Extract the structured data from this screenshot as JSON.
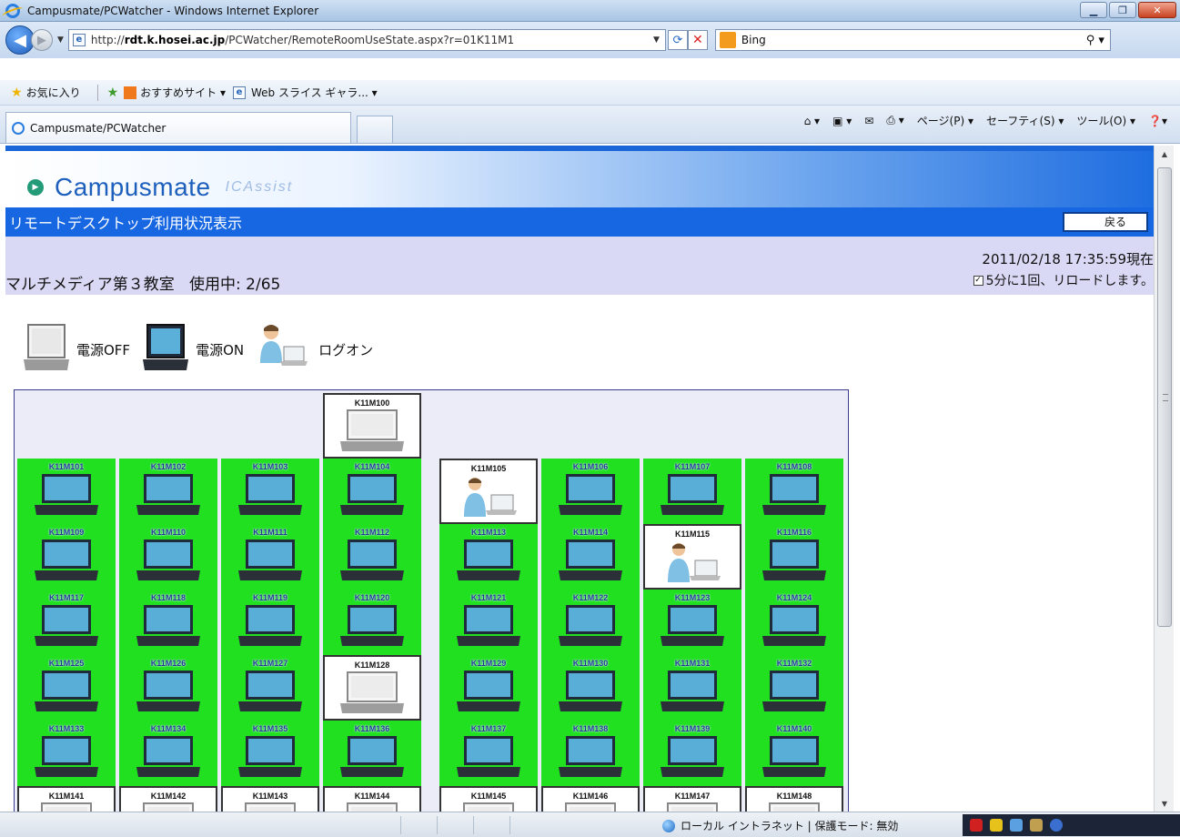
{
  "browser": {
    "title": "Campusmate/PCWatcher - Windows Internet Explorer",
    "url_prefix": "http://",
    "url_host": "rdt.k.hosei.ac.jp",
    "url_path": "/PCWatcher/RemoteRoomUseState.aspx?r=01K11M1",
    "search_engine": "Bing",
    "favorites_label": "お気に入り",
    "suggested_sites": "おすすめサイト ▾",
    "web_slice": "Web スライス ギャラ... ▾",
    "tab_title": "Campusmate/PCWatcher",
    "commands": {
      "page": "ページ(P) ▾",
      "safety": "セーフティ(S) ▾",
      "tools": "ツール(O) ▾"
    }
  },
  "page": {
    "brand": "Campusmate",
    "brand_sub": "ICAssist",
    "title": "リモートデスクトップ利用状況表示",
    "back_label": "戻る",
    "room_name": "マルチメディア第３教室",
    "usage": "使用中: 2/65",
    "timestamp": "2011/02/18 17:35:59現在",
    "reload_text": "5分に1回、リロードします。",
    "reload_checked": true,
    "legend": {
      "off": "電源OFF",
      "on": "電源ON",
      "logon": "ログオン"
    },
    "seats": [
      {
        "id": "K11M100",
        "status": "off"
      },
      {
        "id": "K11M101",
        "status": "on"
      },
      {
        "id": "K11M102",
        "status": "on"
      },
      {
        "id": "K11M103",
        "status": "on"
      },
      {
        "id": "K11M104",
        "status": "on"
      },
      {
        "id": "K11M105",
        "status": "logon"
      },
      {
        "id": "K11M106",
        "status": "on"
      },
      {
        "id": "K11M107",
        "status": "on"
      },
      {
        "id": "K11M108",
        "status": "on"
      },
      {
        "id": "K11M109",
        "status": "on"
      },
      {
        "id": "K11M110",
        "status": "on"
      },
      {
        "id": "K11M111",
        "status": "on"
      },
      {
        "id": "K11M112",
        "status": "on"
      },
      {
        "id": "K11M113",
        "status": "on"
      },
      {
        "id": "K11M114",
        "status": "on"
      },
      {
        "id": "K11M115",
        "status": "logon"
      },
      {
        "id": "K11M116",
        "status": "on"
      },
      {
        "id": "K11M117",
        "status": "on"
      },
      {
        "id": "K11M118",
        "status": "on"
      },
      {
        "id": "K11M119",
        "status": "on"
      },
      {
        "id": "K11M120",
        "status": "on"
      },
      {
        "id": "K11M121",
        "status": "on"
      },
      {
        "id": "K11M122",
        "status": "on"
      },
      {
        "id": "K11M123",
        "status": "on"
      },
      {
        "id": "K11M124",
        "status": "on"
      },
      {
        "id": "K11M125",
        "status": "on"
      },
      {
        "id": "K11M126",
        "status": "on"
      },
      {
        "id": "K11M127",
        "status": "on"
      },
      {
        "id": "K11M128",
        "status": "off"
      },
      {
        "id": "K11M129",
        "status": "on"
      },
      {
        "id": "K11M130",
        "status": "on"
      },
      {
        "id": "K11M131",
        "status": "on"
      },
      {
        "id": "K11M132",
        "status": "on"
      },
      {
        "id": "K11M133",
        "status": "on"
      },
      {
        "id": "K11M134",
        "status": "on"
      },
      {
        "id": "K11M135",
        "status": "on"
      },
      {
        "id": "K11M136",
        "status": "on"
      },
      {
        "id": "K11M137",
        "status": "on"
      },
      {
        "id": "K11M138",
        "status": "on"
      },
      {
        "id": "K11M139",
        "status": "on"
      },
      {
        "id": "K11M140",
        "status": "on"
      },
      {
        "id": "K11M141",
        "status": "off"
      },
      {
        "id": "K11M142",
        "status": "off"
      },
      {
        "id": "K11M143",
        "status": "off"
      },
      {
        "id": "K11M144",
        "status": "off"
      },
      {
        "id": "K11M145",
        "status": "off"
      },
      {
        "id": "K11M146",
        "status": "off"
      },
      {
        "id": "K11M147",
        "status": "off"
      },
      {
        "id": "K11M148",
        "status": "off"
      }
    ]
  },
  "statusbar": {
    "zone": "ローカル イントラネット | 保護モード: 無効"
  },
  "colors": {
    "seat_on": "#20e020",
    "header_blue": "#1767e2",
    "info_bg": "#d9d9f5"
  }
}
